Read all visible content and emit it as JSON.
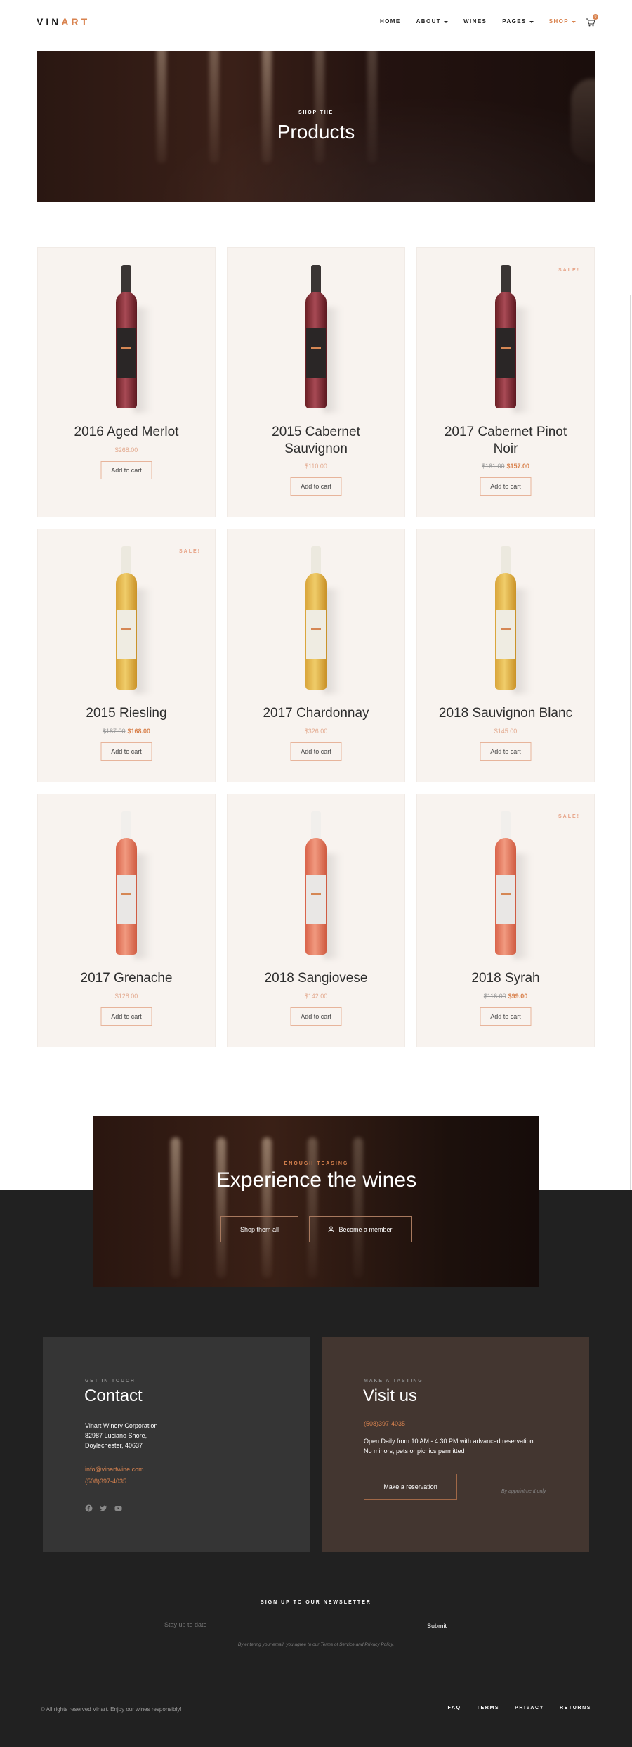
{
  "brand": {
    "name_plain": "VIN",
    "name_accent": "ART"
  },
  "nav": {
    "items": [
      "HOME",
      "ABOUT",
      "WINES",
      "PAGES",
      "SHOP"
    ],
    "cart_count": "0"
  },
  "hero": {
    "kicker": "SHOP THE",
    "title": "Products"
  },
  "products": [
    {
      "name": "2016 Aged Merlot",
      "old_price": "",
      "price": "$268.00",
      "button": "Add to cart",
      "sale": "",
      "type": "red"
    },
    {
      "name": "2015 Cabernet Sauvignon",
      "old_price": "",
      "price": "$110.00",
      "button": "Add to cart",
      "sale": "",
      "type": "red"
    },
    {
      "name": "2017 Cabernet Pinot Noir",
      "old_price": "$161.00",
      "price": "$157.00",
      "button": "Add to cart",
      "sale": "SALE!",
      "type": "red"
    },
    {
      "name": "2015 Riesling",
      "old_price": "$187.00",
      "price": "$168.00",
      "button": "Add to cart",
      "sale": "SALE!",
      "type": "white"
    },
    {
      "name": "2017 Chardonnay",
      "old_price": "",
      "price": "$326.00",
      "button": "Add to cart",
      "sale": "",
      "type": "white"
    },
    {
      "name": "2018 Sauvignon Blanc",
      "old_price": "",
      "price": "$145.00",
      "button": "Add to cart",
      "sale": "",
      "type": "white"
    },
    {
      "name": "2017 Grenache",
      "old_price": "",
      "price": "$128.00",
      "button": "Add to cart",
      "sale": "",
      "type": "rose"
    },
    {
      "name": "2018 Sangiovese",
      "old_price": "",
      "price": "$142.00",
      "button": "Add to cart",
      "sale": "",
      "type": "rose"
    },
    {
      "name": "2018 Syrah",
      "old_price": "$116.00",
      "price": "$99.00",
      "button": "Add to cart",
      "sale": "SALE!",
      "type": "rose"
    }
  ],
  "cta": {
    "kicker": "ENOUGH TEASING",
    "title": "Experience the wines",
    "shop_button": "Shop them all",
    "member_button": "Become a member"
  },
  "contact": {
    "kicker": "GET IN TOUCH",
    "title": "Contact",
    "company": "Vinart Winery Corporation",
    "address1": "82987 Luciano Shore,",
    "address2": "Doylechester, 40637",
    "email": "info@vinartwine.com",
    "phone": "(508)397-4035"
  },
  "visit": {
    "kicker": "MAKE A TASTING",
    "title": "Visit us",
    "phone": "(508)397-4035",
    "hours": "Open Daily from 10 AM - 4:30 PM with advanced reservation",
    "rules": "No minors, pets or picnics permitted",
    "button": "Make a reservation",
    "note": "By appointment only"
  },
  "newsletter": {
    "kicker": "SIGN UP TO OUR NEWSLETTER",
    "placeholder": "Stay up to date",
    "button": "Submit",
    "note": "By entering your email, you agree to our Terms of Service and Privacy Policy."
  },
  "footer": {
    "copyright": "© All rights reserved Vinart. Enjoy our wines responsibly!",
    "links": [
      "FAQ",
      "TERMS",
      "PRIVACY",
      "RETURNS"
    ]
  },
  "colors": {
    "accent": "#d9834f",
    "dark": "#212121",
    "card": "#f8f3ef"
  }
}
